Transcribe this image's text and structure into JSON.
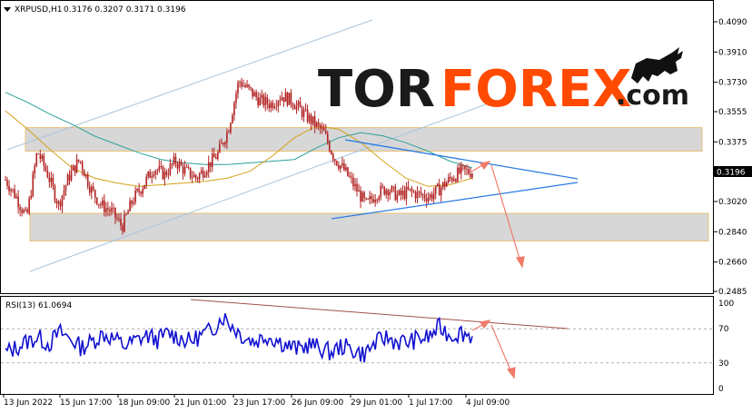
{
  "header": {
    "symbol": "XRPUSD,H1",
    "ohlc": "0.3176 0.3207 0.3171 0.3196",
    "rsi_label": "RSI(13) 61.0694"
  },
  "logo": {
    "part1": "TOR",
    "part2": "FOREX",
    "suffix": ".com",
    "colors": {
      "part1": "#1a1a1a",
      "part2": "#ff4a00",
      "suffix": "#1a1a1a"
    }
  },
  "colors": {
    "candle": "#b22222",
    "ma_slow": "#2aa198",
    "ma_fast": "#d4a017",
    "channel": "#a9c4dc",
    "triangle": "#2a7be4",
    "zone_fill": "#d7d7d7",
    "zone_border": "#e8c27a",
    "arrow": "#f07a6a",
    "rsi_line": "#1010d0",
    "rsi_trend": "#a0524d",
    "price_tag_bg": "#000000",
    "price_tag_fg": "#ffffff"
  },
  "chart_data": [
    {
      "type": "line",
      "series_kind": "candlestick",
      "ylim": [
        0.2485,
        0.4135
      ],
      "yticks": [
        "0.4090",
        "0.3910",
        "0.3730",
        "0.3555",
        "0.3375",
        "0.3195",
        "0.3020",
        "0.2840",
        "0.2660",
        "0.2485"
      ],
      "current_price": "0.3196",
      "x_labels": [
        "13 Jun 2022",
        "15 Jun 17:00",
        "18 Jun 09:00",
        "21 Jun 01:00",
        "23 Jun 17:00",
        "26 Jun 09:00",
        "29 Jun 01:00",
        "1 Jul 17:00",
        "4 Jul 09:00"
      ],
      "anchor_prices": [
        0.315,
        0.305,
        0.292,
        0.332,
        0.318,
        0.3,
        0.317,
        0.327,
        0.31,
        0.3,
        0.296,
        0.287,
        0.303,
        0.312,
        0.322,
        0.318,
        0.326,
        0.32,
        0.316,
        0.323,
        0.33,
        0.345,
        0.374,
        0.368,
        0.362,
        0.36,
        0.365,
        0.362,
        0.355,
        0.349,
        0.343,
        0.328,
        0.32,
        0.31,
        0.3,
        0.307,
        0.31,
        0.305,
        0.308,
        0.306,
        0.305,
        0.31,
        0.316,
        0.32,
        0.3196
      ],
      "ma_slow": [
        0.367,
        0.361,
        0.354,
        0.348,
        0.341,
        0.336,
        0.331,
        0.327,
        0.325,
        0.324,
        0.324,
        0.325,
        0.326,
        0.327,
        0.334,
        0.34,
        0.343,
        0.341,
        0.337,
        0.332,
        0.326,
        0.322
      ],
      "ma_fast": [
        0.356,
        0.345,
        0.333,
        0.322,
        0.316,
        0.313,
        0.311,
        0.312,
        0.313,
        0.314,
        0.316,
        0.32,
        0.329,
        0.34,
        0.347,
        0.345,
        0.337,
        0.326,
        0.316,
        0.311,
        0.312,
        0.316
      ],
      "zones": [
        {
          "top": 0.346,
          "bottom": 0.332
        },
        {
          "top": 0.295,
          "bottom": 0.2785
        }
      ]
    },
    {
      "type": "line",
      "name": "RSI(13)",
      "ylim": [
        0,
        100
      ],
      "yticks": [
        "100",
        "70",
        "30",
        "0"
      ],
      "levels": [
        70,
        30
      ],
      "anchor_values": [
        42,
        48,
        55,
        60,
        52,
        66,
        58,
        48,
        55,
        64,
        58,
        50,
        56,
        62,
        57,
        65,
        60,
        55,
        62,
        68,
        85,
        72,
        60,
        55,
        62,
        57,
        50,
        46,
        52,
        47,
        42,
        50,
        45,
        40,
        52,
        60,
        55,
        54,
        58,
        60,
        72,
        62,
        66,
        61
      ]
    }
  ]
}
